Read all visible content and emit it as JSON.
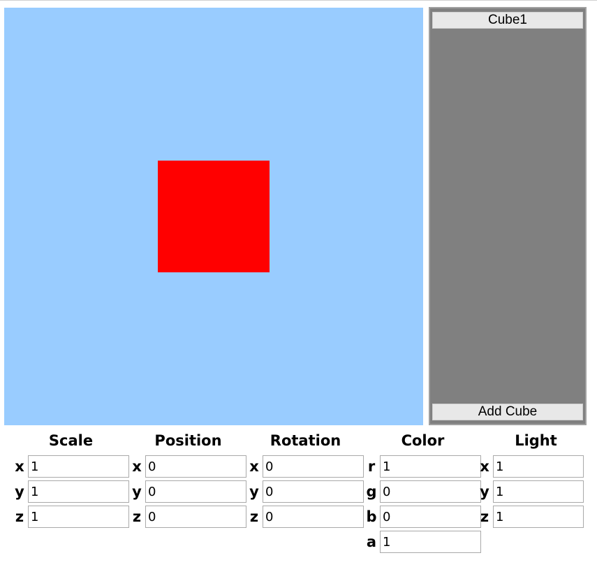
{
  "viewport": {
    "background_color": "#99ccff",
    "cube_color": "#ff0000"
  },
  "object_panel": {
    "items": [
      {
        "label": "Cube1"
      }
    ],
    "add_button_label": "Add Cube"
  },
  "controls": {
    "scale": {
      "title": "Scale",
      "fields": [
        {
          "label": "x",
          "value": "1"
        },
        {
          "label": "y",
          "value": "1"
        },
        {
          "label": "z",
          "value": "1"
        }
      ]
    },
    "position": {
      "title": "Position",
      "fields": [
        {
          "label": "x",
          "value": "0"
        },
        {
          "label": "y",
          "value": "0"
        },
        {
          "label": "z",
          "value": "0"
        }
      ]
    },
    "rotation": {
      "title": "Rotation",
      "fields": [
        {
          "label": "x",
          "value": "0"
        },
        {
          "label": "y",
          "value": "0"
        },
        {
          "label": "z",
          "value": "0"
        }
      ]
    },
    "color": {
      "title": "Color",
      "fields": [
        {
          "label": "r",
          "value": "1"
        },
        {
          "label": "g",
          "value": "0"
        },
        {
          "label": "b",
          "value": "0"
        },
        {
          "label": "a",
          "value": "1"
        }
      ]
    },
    "light": {
      "title": "Light",
      "fields": [
        {
          "label": "x",
          "value": "1"
        },
        {
          "label": "y",
          "value": "1"
        },
        {
          "label": "z",
          "value": "1"
        }
      ]
    }
  }
}
